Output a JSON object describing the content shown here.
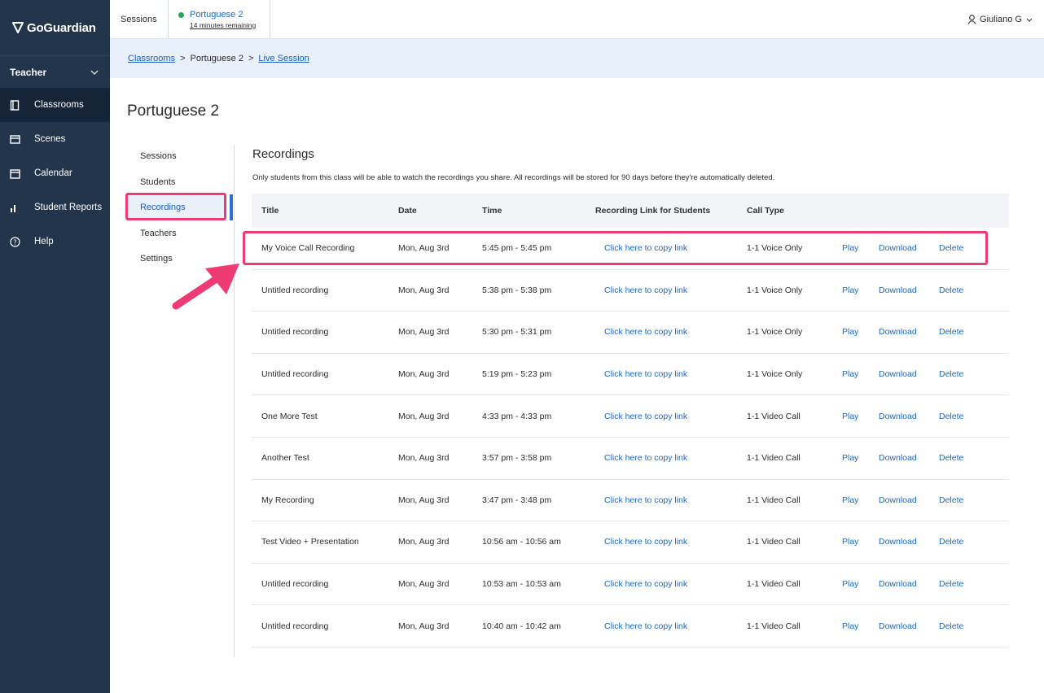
{
  "brand": {
    "name": "GoGuardian"
  },
  "sidebar": {
    "role": "Teacher",
    "items": [
      {
        "label": "Classrooms",
        "icon": "classroom-icon",
        "active": true
      },
      {
        "label": "Scenes",
        "icon": "scenes-icon",
        "active": false
      },
      {
        "label": "Calendar",
        "icon": "calendar-icon",
        "active": false
      },
      {
        "label": "Student Reports",
        "icon": "bar-chart-icon",
        "active": false
      },
      {
        "label": "Help",
        "icon": "help-icon",
        "active": false
      }
    ]
  },
  "topbar": {
    "sessions_label": "Sessions",
    "current_session": "Portuguese 2",
    "remaining": "14 minutes remaining",
    "user": "Giuliano G"
  },
  "breadcrumb": {
    "root": "Classrooms",
    "middle": "Portuguese 2",
    "current": "Live Session"
  },
  "page": {
    "title": "Portuguese 2"
  },
  "subnav": [
    "Sessions",
    "Students",
    "Recordings",
    "Teachers",
    "Settings"
  ],
  "recordings": {
    "title": "Recordings",
    "description": "Only students from this class will be able to watch the recordings you share. All recordings will be stored for 90 days before they're automatically deleted.",
    "columns": [
      "Title",
      "Date",
      "Time",
      "Recording Link for Students",
      "Call Type"
    ],
    "actions": {
      "play": "Play",
      "download": "Download",
      "delete": "Delete",
      "copy": "Click here to copy link"
    },
    "rows": [
      {
        "title": "My Voice Call Recording",
        "date": "Mon, Aug 3rd",
        "time": "5:45 pm - 5:45 pm",
        "type": "1-1 Voice Only"
      },
      {
        "title": "Untitled recording",
        "date": "Mon, Aug 3rd",
        "time": "5:38 pm - 5:38 pm",
        "type": "1-1 Voice Only"
      },
      {
        "title": "Untitled recording",
        "date": "Mon, Aug 3rd",
        "time": "5:30 pm - 5:31 pm",
        "type": "1-1 Voice Only"
      },
      {
        "title": "Untitled recording",
        "date": "Mon, Aug 3rd",
        "time": "5:19 pm - 5:23 pm",
        "type": "1-1 Voice Only"
      },
      {
        "title": "One More Test",
        "date": "Mon, Aug 3rd",
        "time": "4:33 pm - 4:33 pm",
        "type": "1-1 Video Call"
      },
      {
        "title": "Another Test",
        "date": "Mon, Aug 3rd",
        "time": "3:57 pm - 3:58 pm",
        "type": "1-1 Video Call"
      },
      {
        "title": "My Recording",
        "date": "Mon, Aug 3rd",
        "time": "3:47 pm - 3:48 pm",
        "type": "1-1 Video Call"
      },
      {
        "title": "Test Video + Presentation",
        "date": "Mon, Aug 3rd",
        "time": "10:56 am - 10:56 am",
        "type": "1-1 Video Call"
      },
      {
        "title": "Untitled recording",
        "date": "Mon, Aug 3rd",
        "time": "10:53 am - 10:53 am",
        "type": "1-1 Video Call"
      },
      {
        "title": "Untitled recording",
        "date": "Mon, Aug 3rd",
        "time": "10:40 am - 10:42 am",
        "type": "1-1 Video Call"
      }
    ]
  },
  "colors": {
    "sidebar": "#23354a",
    "accent": "#1a6ac4",
    "highlight": "#ef3b73"
  }
}
